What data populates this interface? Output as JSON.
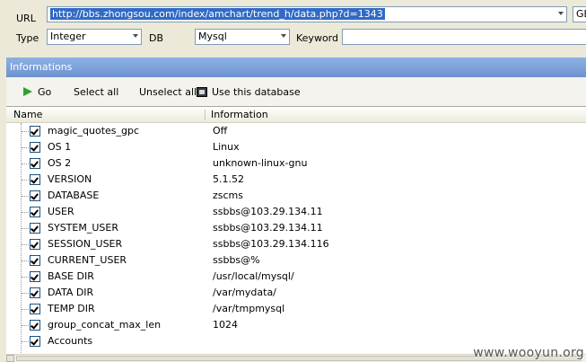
{
  "form": {
    "url_label": "URL",
    "url_value": "http://bbs.zhongsou.com/index/amchart/trend_h/data.php?d=1343",
    "encoding_value": "GE",
    "type_label": "Type",
    "type_value": "Integer",
    "db_label": "DB",
    "db_value": "Mysql",
    "keyword_label": "Keyword",
    "keyword_value": ""
  },
  "panel": {
    "title": "Informations",
    "actions": {
      "go": "Go",
      "select_all": "Select all",
      "unselect_all": "Unselect all",
      "use_db": "Use this database"
    }
  },
  "table": {
    "headers": [
      "Name",
      "Information"
    ],
    "rows": [
      {
        "name": "magic_quotes_gpc",
        "value": "Off"
      },
      {
        "name": "OS 1",
        "value": "Linux"
      },
      {
        "name": "OS 2",
        "value": "unknown-linux-gnu"
      },
      {
        "name": "VERSION",
        "value": "5.1.52"
      },
      {
        "name": "DATABASE",
        "value": "zscms"
      },
      {
        "name": "USER",
        "value": "ssbbs@103.29.134.11"
      },
      {
        "name": "SYSTEM_USER",
        "value": "ssbbs@103.29.134.11"
      },
      {
        "name": "SESSION_USER",
        "value": "ssbbs@103.29.134.116"
      },
      {
        "name": "CURRENT_USER",
        "value": "ssbbs@%"
      },
      {
        "name": "BASE DIR",
        "value": "/usr/local/mysql/"
      },
      {
        "name": "DATA DIR",
        "value": "/var/mydata/"
      },
      {
        "name": "TEMP DIR",
        "value": "/var/tmpmysql"
      },
      {
        "name": "group_concat_max_len",
        "value": "1024"
      },
      {
        "name": "Accounts",
        "value": ""
      }
    ]
  },
  "watermark": "www.wooyun.org"
}
